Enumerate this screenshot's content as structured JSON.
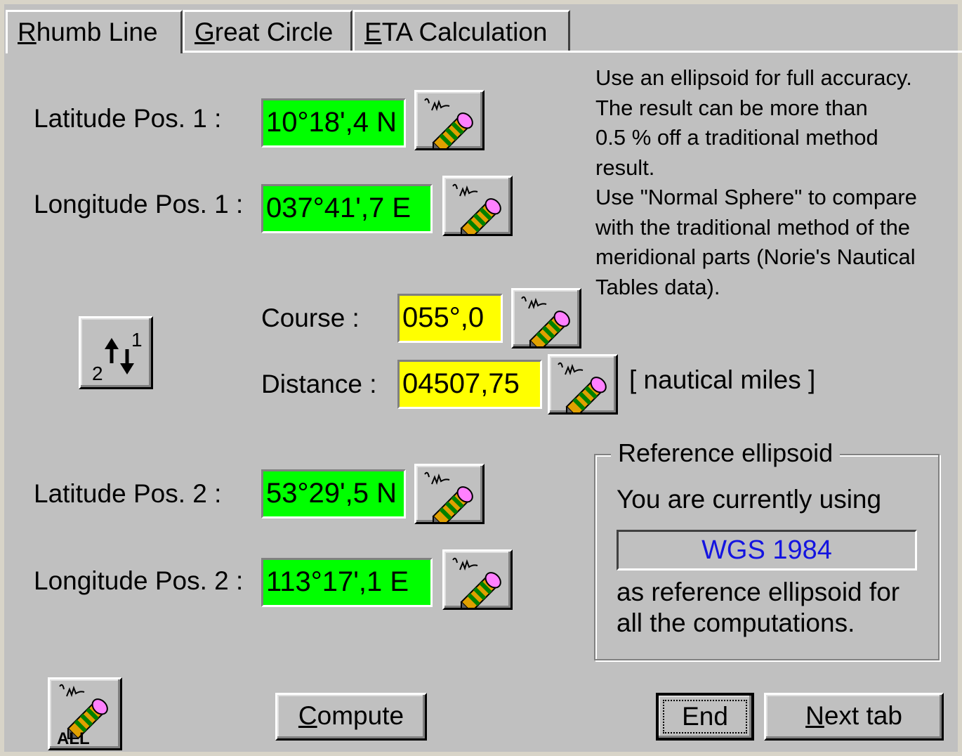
{
  "tabs": [
    {
      "label": "Rhumb Line",
      "accel": "R",
      "active": true
    },
    {
      "label": "Great Circle",
      "accel": "G",
      "active": false
    },
    {
      "label": "ETA Calculation",
      "accel": "E",
      "active": false
    }
  ],
  "fields": {
    "lat1": {
      "label": "Latitude Pos. 1 :",
      "value": "10°18',4 N",
      "color": "#00ff00"
    },
    "lon1": {
      "label": "Longitude Pos. 1 :",
      "value": "037°41',7 E",
      "color": "#00ff00"
    },
    "course": {
      "label": "Course :",
      "value": "055°,0",
      "color": "#ffff00"
    },
    "distance": {
      "label": "Distance :",
      "value": "04507,75",
      "color": "#ffff00",
      "unit": "[ nautical miles ]"
    },
    "lat2": {
      "label": "Latitude Pos. 2 :",
      "value": "53°29',5 N",
      "color": "#00ff00"
    },
    "lon2": {
      "label": "Longitude Pos. 2 :",
      "value": "113°17',1 E",
      "color": "#00ff00"
    }
  },
  "note_lines": [
    "Use an ellipsoid for full accuracy.",
    "The result can be more than",
    "0.5 % off a traditional method",
    "result.",
    "Use \"Normal Sphere\" to compare",
    "with the traditional method of the",
    "meridional parts (Norie's Nautical",
    "Tables data)."
  ],
  "reference": {
    "title": "Reference ellipsoid",
    "line1": "You are currently using",
    "ellipsoid": "WGS 1984",
    "line2": "as reference ellipsoid for",
    "line3": "all the computations."
  },
  "buttons": {
    "compute": "Compute",
    "end": "End",
    "next_tab": "Next tab",
    "swap_top": "1",
    "swap_bottom": "2",
    "all": "ALL"
  },
  "icons": {
    "edit": "pencil-edit-icon",
    "swap": "swap-positions-icon",
    "edit_all": "pencil-edit-all-icon"
  }
}
